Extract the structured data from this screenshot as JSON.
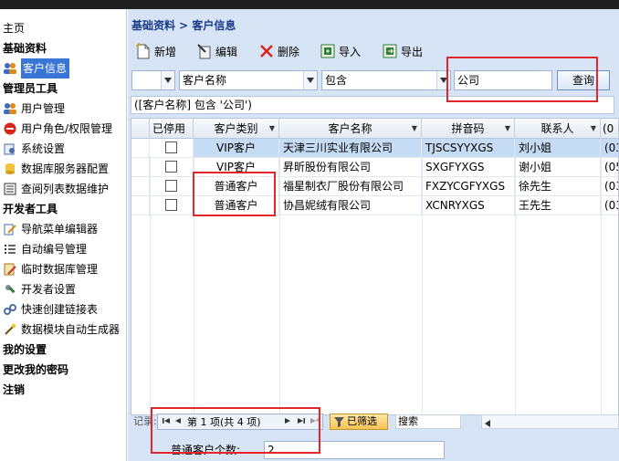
{
  "sidebar": {
    "home": "主页",
    "groups": {
      "basic": "基础资料",
      "admin": "管理员工具",
      "dev": "开发者工具",
      "my_settings": "我的设置",
      "change_password": "更改我的密码",
      "logout": "注销"
    },
    "items": {
      "customer_info": "客户信息",
      "user_mgmt": "用户管理",
      "roles": "用户角色/权限管理",
      "sys_settings": "系统设置",
      "db_server": "数据库服务器配置",
      "query_list": "查阅列表数据维护",
      "nav_editor": "导航菜单编辑器",
      "auto_number": "自动编号管理",
      "temp_db": "临时数据库管理",
      "dev_settings": "开发者设置",
      "quick_link": "快速创建链接表",
      "auto_gen": "数据模块自动生成器"
    }
  },
  "breadcrumb": "基础资料 > 客户信息",
  "toolbar": {
    "add": "新增",
    "edit": "编辑",
    "delete": "删除",
    "import": "导入",
    "export": "导出"
  },
  "filter": {
    "logic": "",
    "field": "客户名称",
    "operator": "包含",
    "value": "公司",
    "query_button": "查询"
  },
  "criteria_text": "([客户名称] 包含 '公司')",
  "grid": {
    "columns": [
      "已停用",
      "客户类别",
      "客户名称",
      "拼音码",
      "联系人",
      "(0"
    ],
    "rows": [
      {
        "type": "VIP客户",
        "name": "天津三川实业有限公司",
        "pinyin": "TJSCSYYXGS",
        "contact": "刘小姐",
        "phone": "(03",
        "selected": true
      },
      {
        "type": "VIP客户",
        "name": "昇昕股份有限公司",
        "pinyin": "SXGFYXGS",
        "contact": "谢小姐",
        "phone": "(05",
        "selected": false
      },
      {
        "type": "普通客户",
        "name": "福星制衣厂股份有限公司",
        "pinyin": "FXZYCGFYXGS",
        "contact": "徐先生",
        "phone": "(03",
        "selected": false
      },
      {
        "type": "普通客户",
        "name": "协昌妮绒有限公司",
        "pinyin": "XCNRYXGS",
        "contact": "王先生",
        "phone": "(03",
        "selected": false
      }
    ]
  },
  "navigator": {
    "record_label": "记录:",
    "position": "第 1 项(共 4 项)",
    "filtered": "已筛选",
    "search": "搜索"
  },
  "summary": {
    "label": "普通客户个数:",
    "value": "2"
  },
  "colors": {
    "highlight": "#e3262a",
    "selection": "#3875d7",
    "panel": "#d6e4f5"
  }
}
